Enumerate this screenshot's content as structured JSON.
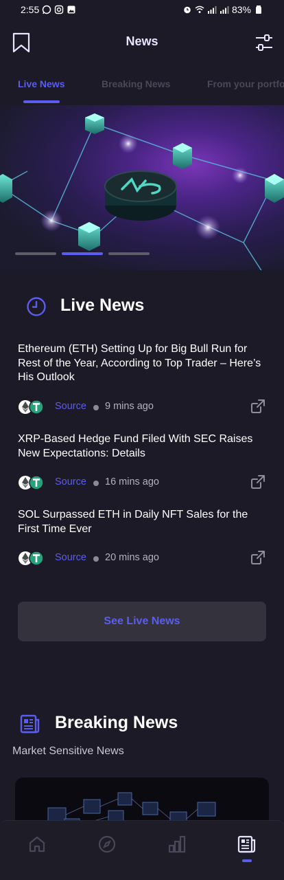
{
  "status_bar": {
    "time": "2:55",
    "battery": "83%"
  },
  "header": {
    "title": "News"
  },
  "tabs": [
    {
      "label": "Live News",
      "active": true
    },
    {
      "label": "Breaking News",
      "active": false
    },
    {
      "label": "From your portfo",
      "active": false
    }
  ],
  "hero": {
    "slide_count": 3,
    "active_slide": 2
  },
  "live_news": {
    "title": "Live News",
    "items": [
      {
        "title": "Ethereum (ETH) Setting Up for Big Bull Run for Rest of the Year, According to Top Trader – Here’s His Outlook",
        "source": "Source",
        "time": "9 mins ago"
      },
      {
        "title": "XRP-Based Hedge Fund Filed With SEC Raises New Expectations: Details",
        "source": "Source",
        "time": "16 mins ago"
      },
      {
        "title": "SOL Surpassed ETH in Daily NFT Sales for the First Time Ever",
        "source": "Source",
        "time": "20 mins ago"
      }
    ],
    "see_button": "See Live News"
  },
  "breaking_news": {
    "title": "Breaking News",
    "subtitle": "Market Sensitive News"
  },
  "bottom_nav": {
    "items": [
      "home-icon",
      "compass-icon",
      "chart-icon",
      "news-icon"
    ],
    "active_index": 3
  },
  "colors": {
    "background": "#1b1a26",
    "accent": "#5b5cf0",
    "inactive_tab": "#4a4858",
    "button_bg": "#34333d"
  }
}
